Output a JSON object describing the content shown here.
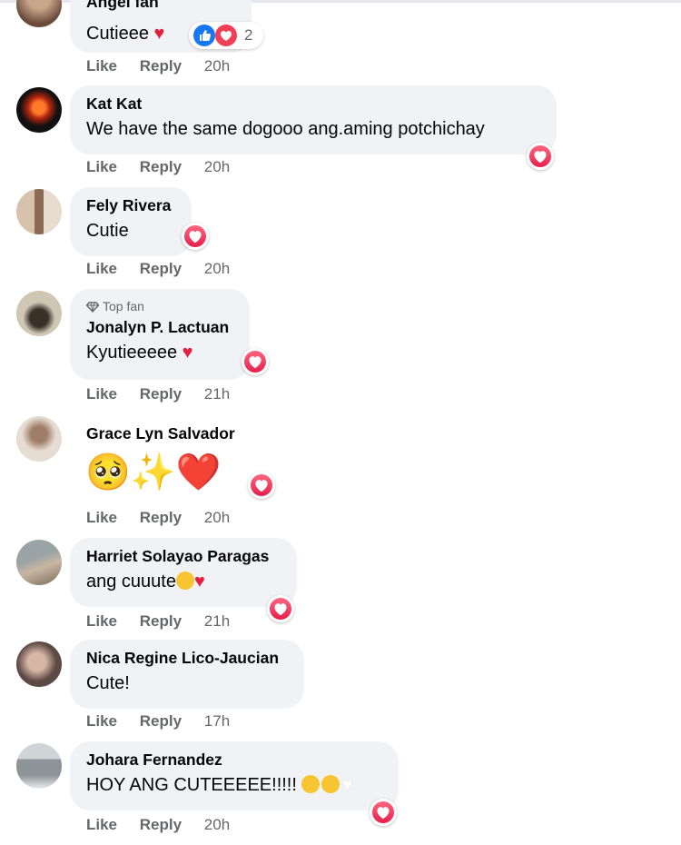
{
  "actions": {
    "like": "Like",
    "reply": "Reply"
  },
  "comments": [
    {
      "name": "Angel fan",
      "text": "Cutieee",
      "time": "20h",
      "reaction_count": "2"
    },
    {
      "name": "Kat Kat",
      "text": "We have the same dogooo ang.aming potchichay",
      "time": "20h"
    },
    {
      "name": "Fely Rivera",
      "text": "Cutie",
      "time": "20h"
    },
    {
      "name": "Jonalyn P. Lactuan",
      "badge": "Top fan",
      "text": "Kyutieeeee",
      "time": "21h"
    },
    {
      "name": "Grace Lyn Salvador",
      "text": "🥺✨❤️",
      "time": "20h"
    },
    {
      "name": "Harriet Solayao Paragas",
      "text": "ang cuuute",
      "time": "21h"
    },
    {
      "name": "Nica Regine Lico-Jaucian",
      "text": "Cute!",
      "time": "17h"
    },
    {
      "name": "Johara Fernandez",
      "text": "HOY ANG CUTEEEEE!!!!!",
      "time": "20h"
    }
  ],
  "colors": {
    "like_blue": "#1877f2",
    "love_red": "#f33e58",
    "bubble": "#f0f2f5",
    "meta_gray": "#65676b"
  }
}
